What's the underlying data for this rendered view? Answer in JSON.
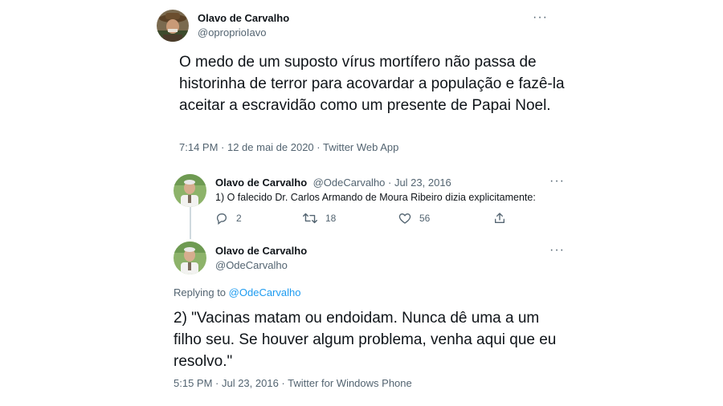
{
  "main_tweet": {
    "display_name": "Olavo de Carvalho",
    "handle": "@oproprioIavo",
    "more_label": "···",
    "text": "O medo de um suposto vírus mortífero não passa de historinha de terror para acovardar a população e fazê-la aceitar a escravidão como um presente de Papai Noel.",
    "timestamp": "7:14 PM · 12 de mai de 2020 · Twitter Web App"
  },
  "quoted_tweet": {
    "display_name": "Olavo de Carvalho",
    "handle_time": "@OdeCarvalho · Jul 23, 2016",
    "more_label": "···",
    "text": "1) O falecido Dr. Carlos Armando de Moura Ribeiro dizia explicitamente:",
    "reply_count": "2",
    "retweet_count": "18",
    "like_count": "56"
  },
  "reply_tweet": {
    "display_name": "Olavo de Carvalho",
    "handle": "@OdeCarvalho",
    "more_label": "···",
    "replying_prefix": "Replying to",
    "replying_to": "@OdeCarvalho",
    "text": "2) \"Vacinas matam ou endoidam. Nunca dê uma a um filho seu. Se houver algum problema, venha aqui que eu resolvo.\"",
    "timestamp": "5:15 PM · Jul 23, 2016 · Twitter for Windows Phone"
  },
  "icons": [
    "avatar",
    "more-icon",
    "reply-icon",
    "retweet-icon",
    "like-icon",
    "share-icon"
  ],
  "colors": {
    "link": "#1d9bf0",
    "secondary_text": "#536471",
    "thread_line": "#cfd9de"
  }
}
